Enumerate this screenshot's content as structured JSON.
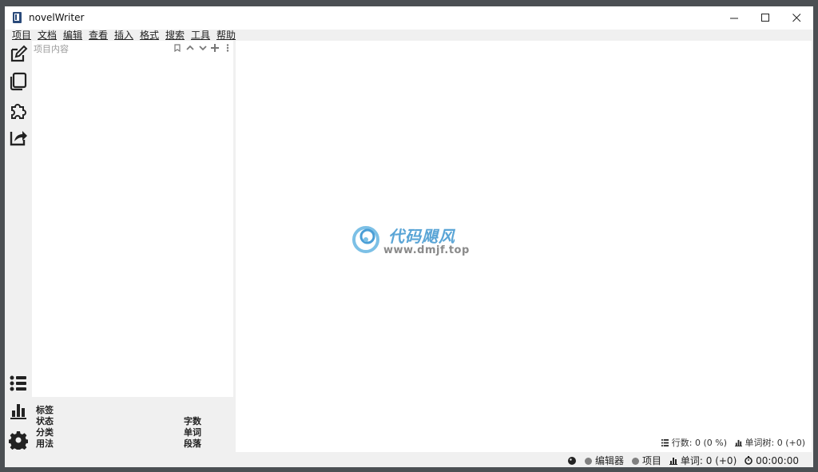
{
  "window": {
    "title": "novelWriter"
  },
  "menu": [
    "项目",
    "文档",
    "编辑",
    "查看",
    "插入",
    "格式",
    "搜索",
    "工具",
    "帮助"
  ],
  "toolbar": {
    "top_icons": [
      "edit-icon",
      "novel-view-icon",
      "plugin-icon",
      "export-icon"
    ],
    "bottom_icons": [
      "outline-list-icon",
      "stats-icon",
      "settings-icon"
    ]
  },
  "project_panel": {
    "header": "项目内容"
  },
  "outline": {
    "tag_label": "标签",
    "status_label": "状态",
    "class_label": "分类",
    "usage_label": "用法",
    "chars_label": "字数",
    "words_label": "单词",
    "paras_label": "段落"
  },
  "editor_footer": {
    "lines": "行数: 0 (0 %)",
    "word_tree": "单词树: 0 (+0)"
  },
  "statusbar": {
    "editor_label": "编辑器",
    "project_label": "项目",
    "words": "单词: 0 (+0)",
    "time": "00:00:00"
  },
  "watermark": {
    "title": "代码飓风",
    "url": "www.dmjf.top"
  },
  "colors": {
    "window_bg": "#f0f0f0",
    "panel_bg": "#ffffff",
    "status_dot": "#808080",
    "watermark_blue": "#5aa5d6"
  }
}
